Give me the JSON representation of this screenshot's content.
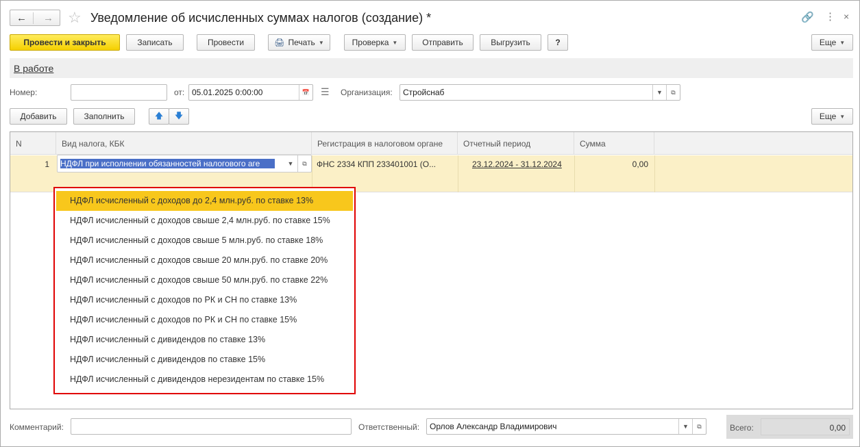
{
  "title": "Уведомление об исчисленных суммах налогов (создание) *",
  "toolbar": {
    "post_close": "Провести и закрыть",
    "save": "Записать",
    "post": "Провести",
    "print": "Печать",
    "check": "Проверка",
    "send": "Отправить",
    "export": "Выгрузить",
    "help": "?",
    "more": "Еще"
  },
  "status_link": "В работе",
  "form": {
    "number_label": "Номер:",
    "number_value": "",
    "date_label": "от:",
    "date_value": "05.01.2025  0:00:00",
    "org_label": "Организация:",
    "org_value": "Стройснаб"
  },
  "table_toolbar": {
    "add": "Добавить",
    "fill": "Заполнить",
    "more": "Еще"
  },
  "table": {
    "columns": [
      "N",
      "Вид налога, КБК",
      "Регистрация в налоговом органе",
      "Отчетный период",
      "Сумма"
    ],
    "rows": [
      {
        "n": "1",
        "tax": "НДФЛ при исполнении обязанностей налогового аге",
        "registration": "ФНС 2334 КПП 233401001 (О...",
        "period": "23.12.2024 - 31.12.2024",
        "sum": "0,00"
      }
    ]
  },
  "dropdown": {
    "items": [
      "НДФЛ исчисленный с доходов до 2,4 млн.руб. по ставке 13%",
      "НДФЛ исчисленный с доходов свыше 2,4 млн.руб. по ставке 15%",
      "НДФЛ исчисленный с доходов свыше 5 млн.руб. по ставке 18%",
      "НДФЛ исчисленный с доходов свыше 20 млн.руб. по ставке 20%",
      "НДФЛ исчисленный с доходов свыше 50 млн.руб. по ставке 22%",
      "НДФЛ исчисленный с доходов по РК и СН по ставке 13%",
      "НДФЛ исчисленный с доходов по РК и СН по ставке 15%",
      "НДФЛ исчисленный с дивидендов по ставке 13%",
      "НДФЛ исчисленный с дивидендов по ставке 15%",
      "НДФЛ исчисленный с дивидендов нерезидентам по ставке 15%"
    ],
    "selected_index": 0,
    "highlight_color": "#e00000"
  },
  "footer": {
    "comment_label": "Комментарий:",
    "comment_value": "",
    "responsible_label": "Ответственный:",
    "responsible_value": "Орлов Александр Владимирович",
    "total_label": "Всего:",
    "total_value": "0,00"
  },
  "colors": {
    "primary_button": "#f5d000",
    "selected_row": "#fbf0c7",
    "selection": "#4a6fc7"
  }
}
